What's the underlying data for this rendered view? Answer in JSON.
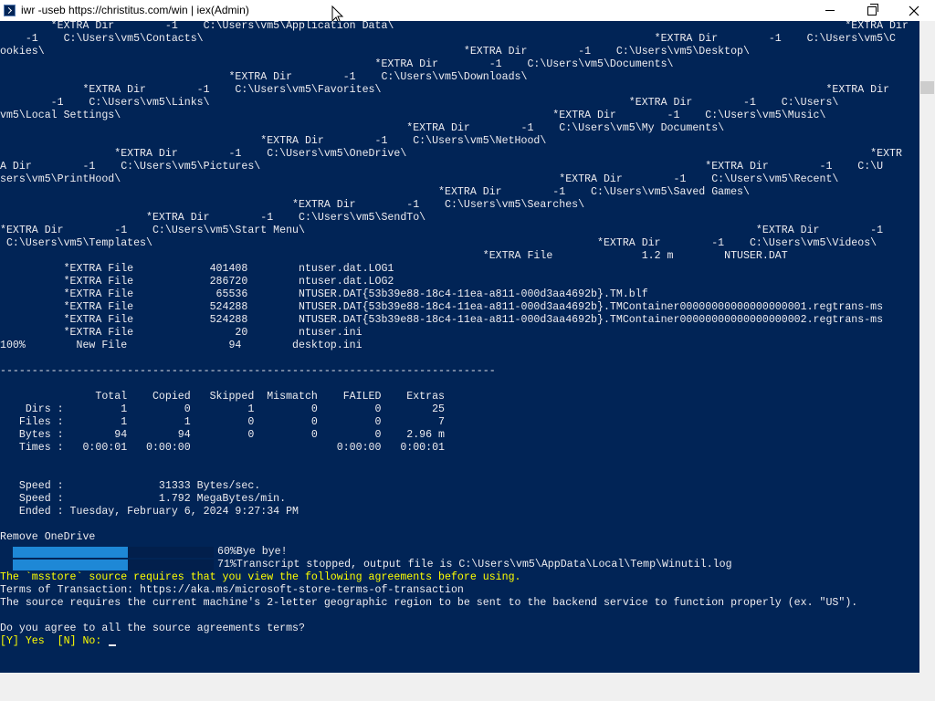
{
  "window": {
    "title": "iwr -useb https://christitus.com/win | iex(Admin)",
    "controls": {
      "minimize_icon": "minimize-icon",
      "maximize_icon": "maximize-icon",
      "close_icon": "close-icon"
    }
  },
  "colors": {
    "console_bg": "#012456",
    "console_fg": "#eeedf0",
    "prompt_yellow": "#ffff00",
    "progress_fill": "#1e88d6"
  },
  "console": {
    "lines": [
      "        *EXTRA Dir        -1    C:\\Users\\vm5\\Application Data\\                                                                       *EXTRA Dir",
      "    -1    C:\\Users\\vm5\\Contacts\\                                                                       *EXTRA Dir        -1    C:\\Users\\vm5\\C",
      "ookies\\                                                                  *EXTRA Dir        -1    C:\\Users\\vm5\\Desktop\\",
      "                                                           *EXTRA Dir        -1    C:\\Users\\vm5\\Documents\\",
      "                                    *EXTRA Dir        -1    C:\\Users\\vm5\\Downloads\\",
      "             *EXTRA Dir        -1    C:\\Users\\vm5\\Favorites\\                                                                      *EXTRA Dir",
      "        -1    C:\\Users\\vm5\\Links\\                                                                  *EXTRA Dir        -1    C:\\Users\\",
      "vm5\\Local Settings\\                                                                    *EXTRA Dir        -1    C:\\Users\\vm5\\Music\\",
      "                                                                *EXTRA Dir        -1    C:\\Users\\vm5\\My Documents\\",
      "                                         *EXTRA Dir        -1    C:\\Users\\vm5\\NetHood\\",
      "                  *EXTRA Dir        -1    C:\\Users\\vm5\\OneDrive\\                                                                         *EXTR",
      "A Dir        -1    C:\\Users\\vm5\\Pictures\\                                                                      *EXTRA Dir        -1    C:\\U",
      "sers\\vm5\\PrintHood\\                                                                     *EXTRA Dir        -1    C:\\Users\\vm5\\Recent\\",
      "                                                                     *EXTRA Dir        -1    C:\\Users\\vm5\\Saved Games\\",
      "                                              *EXTRA Dir        -1    C:\\Users\\vm5\\Searches\\",
      "                       *EXTRA Dir        -1    C:\\Users\\vm5\\SendTo\\",
      "*EXTRA Dir        -1    C:\\Users\\vm5\\Start Menu\\                                                                       *EXTRA Dir        -1",
      " C:\\Users\\vm5\\Templates\\                                                                      *EXTRA Dir        -1    C:\\Users\\vm5\\Videos\\",
      "                                                                            *EXTRA File              1.2 m        NTUSER.DAT",
      "          *EXTRA File            401408        ntuser.dat.LOG1",
      "          *EXTRA File            286720        ntuser.dat.LOG2",
      "          *EXTRA File             65536        NTUSER.DAT{53b39e88-18c4-11ea-a811-000d3aa4692b}.TM.blf",
      "          *EXTRA File            524288        NTUSER.DAT{53b39e88-18c4-11ea-a811-000d3aa4692b}.TMContainer00000000000000000001.regtrans-ms",
      "          *EXTRA File            524288        NTUSER.DAT{53b39e88-18c4-11ea-a811-000d3aa4692b}.TMContainer00000000000000000002.regtrans-ms",
      "          *EXTRA File                20        ntuser.ini",
      "100%        New File                94        desktop.ini",
      "",
      "------------------------------------------------------------------------------",
      "",
      "               Total    Copied   Skipped  Mismatch    FAILED    Extras",
      "    Dirs :         1         0         1         0         0        25",
      "   Files :         1         1         0         0         0         7",
      "   Bytes :        94        94         0         0         0    2.96 m",
      "   Times :   0:00:01   0:00:00                       0:00:00   0:00:01",
      "",
      "",
      "   Speed :               31333 Bytes/sec.",
      "   Speed :               1.792 MegaBytes/min.",
      "   Ended : Tuesday, February 6, 2024 9:27:34 PM",
      "",
      "Remove OneDrive"
    ],
    "progress": [
      {
        "percent": 60,
        "text": "60%Bye bye!"
      },
      {
        "percent": 71,
        "text": "71%Transcript stopped, output file is C:\\Users\\vm5\\AppData\\Local\\Temp\\Winutil.log"
      }
    ],
    "agreement_notice": "The `msstore` source requires that you view the following agreements before using.",
    "terms_line": "Terms of Transaction: https://aka.ms/microsoft-store-terms-of-transaction",
    "region_line": "The source requires the current machine's 2-letter geographic region to be sent to the backend service to function properly (ex. \"US\").",
    "question": "Do you agree to all the source agreements terms?",
    "prompt": "[Y] Yes  [N] No: "
  }
}
